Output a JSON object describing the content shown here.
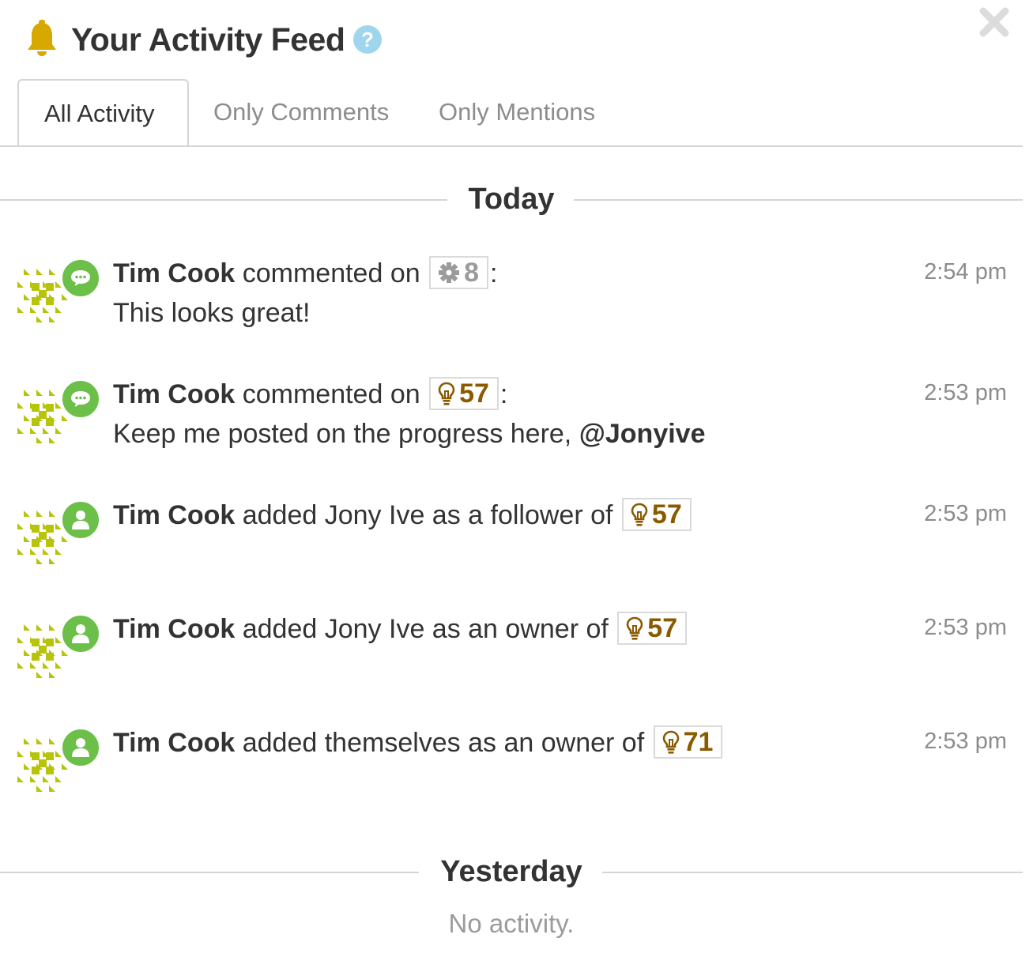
{
  "header": {
    "title": "Your Activity Feed"
  },
  "tabs": [
    {
      "label": "All Activity",
      "active": true
    },
    {
      "label": "Only Comments",
      "active": false
    },
    {
      "label": "Only Mentions",
      "active": false
    }
  ],
  "sections": {
    "today": "Today",
    "yesterday": "Yesterday",
    "empty_text": "No activity."
  },
  "colors": {
    "badge": "#6cc04a",
    "avatar": "#b7c40a",
    "bell": "#d6a800",
    "help": "#9fd6ee",
    "idea": "#8a5a00"
  },
  "items": [
    {
      "user": "Tim Cook",
      "action": "commented on",
      "ref_icon": "gear-icon",
      "ref": "8",
      "suffix": ":",
      "comment": "This looks great!",
      "time": "2:54 pm",
      "badge_icon": "comment-icon"
    },
    {
      "user": "Tim Cook",
      "action": "commented on",
      "ref_icon": "lightbulb-icon",
      "ref": "57",
      "suffix": ":",
      "comment": "Keep me posted on the progress here, ",
      "mention": "@Jonyive",
      "time": "2:53 pm",
      "badge_icon": "comment-icon"
    },
    {
      "user": "Tim Cook",
      "action": "added Jony Ive as a follower of",
      "ref_icon": "lightbulb-icon",
      "ref": "57",
      "time": "2:53 pm",
      "badge_icon": "user-icon"
    },
    {
      "user": "Tim Cook",
      "action": "added Jony Ive as an owner of",
      "ref_icon": "lightbulb-icon",
      "ref": "57",
      "time": "2:53 pm",
      "badge_icon": "user-icon"
    },
    {
      "user": "Tim Cook",
      "action": "added themselves as an owner of",
      "ref_icon": "lightbulb-icon",
      "ref": "71",
      "time": "2:53 pm",
      "badge_icon": "user-icon"
    }
  ]
}
